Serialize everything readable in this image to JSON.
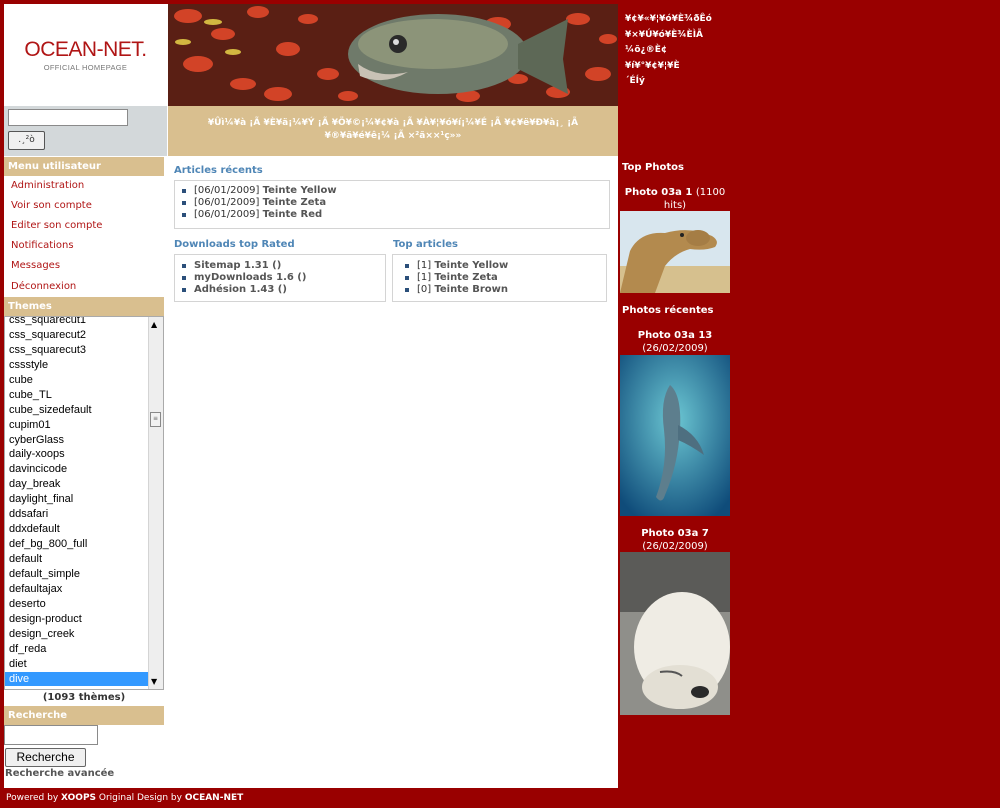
{
  "header": {
    "logo_title": "OCEAN-NET.",
    "logo_subtitle": "OFFICIAL HOMEPAGE",
    "slogan_line1": "¥Ûì¼¥à ¡Ã ¥È¥ä¡¼¥Ý ¡Ã ¥Ö¥©¡¼¥¢¥à ¡Ã ¥À¥¦¥ó¥í¡¼¥É ¡Ã ¥¢¥ë¥Ð¥à¡¸ ¡Ã",
    "slogan_line2": "¥®¥ã¥é¥ê¡¼ ¡Ã ×²ã××¹ç»»",
    "right_text_lines": [
      "¥¢¥«¥¦¥ó¥È¾ðÊó",
      "¥×¥Ú¥ó¥È¾ÈÌÃ",
      "¼õ¿®È¢",
      "¥í¥°¥¢¥¦¥È",
      "´ÉÍý"
    ],
    "search_button_label": ".¸²ò"
  },
  "sidebar": {
    "menu_title": "Menu utilisateur",
    "menu_items": [
      "Administration",
      "Voir son compte",
      "Editer son compte",
      "Notifications",
      "Messages",
      "Déconnexion"
    ],
    "themes_title": "Themes",
    "themes": [
      "css_squarecut1",
      "css_squarecut2",
      "css_squarecut3",
      "cssstyle",
      "cube",
      "cube_TL",
      "cube_sizedefault",
      "cupim01",
      "cyberGlass",
      "daily-xoops",
      "davincicode",
      "day_break",
      "daylight_final",
      "ddsafari",
      "ddxdefault",
      "def_bg_800_full",
      "default",
      "default_simple",
      "defaultajax",
      "deserto",
      "design-product",
      "design_creek",
      "df_reda",
      "diet",
      "dive"
    ],
    "selected_theme": "dive",
    "theme_count": "(1093 thèmes)",
    "search_title": "Recherche",
    "search_button": "Recherche",
    "advanced_search": "Recherche avancée"
  },
  "center": {
    "recent_articles": {
      "title": "Articles récents",
      "items": [
        {
          "date": "[06/01/2009]",
          "name": "Teinte Yellow"
        },
        {
          "date": "[06/01/2009]",
          "name": "Teinte Zeta"
        },
        {
          "date": "[06/01/2009]",
          "name": "Teinte Red"
        }
      ]
    },
    "downloads": {
      "title": "Downloads top Rated",
      "items": [
        "Sitemap 1.31 ()",
        "myDownloads 1.6 ()",
        "Adhésion 1.43 ()"
      ]
    },
    "top_articles": {
      "title": "Top articles",
      "items": [
        {
          "count": "[1]",
          "name": "Teinte Yellow"
        },
        {
          "count": "[1]",
          "name": "Teinte Zeta"
        },
        {
          "count": "[0]",
          "name": "Teinte Brown"
        }
      ]
    }
  },
  "right": {
    "top_photos_title": "Top Photos",
    "top_photo": {
      "name": "Photo 03a 1",
      "meta": "(1100 hits)"
    },
    "recent_photos_title": "Photos récentes",
    "recent_photos": [
      {
        "name": "Photo 03a 13",
        "meta": "(26/02/2009)"
      },
      {
        "name": "Photo 03a 7",
        "meta": "(26/02/2009)"
      }
    ]
  },
  "footer": {
    "powered_prefix": "Powered by ",
    "powered_name": "XOOPS",
    "design_prefix": " Original Design by ",
    "design_name": "OCEAN-NET"
  },
  "colors": {
    "frame": "#990000",
    "section_header": "#d9bf8f",
    "link": "#b01515",
    "block_title": "#4f86b6",
    "selection": "#3399ff"
  }
}
